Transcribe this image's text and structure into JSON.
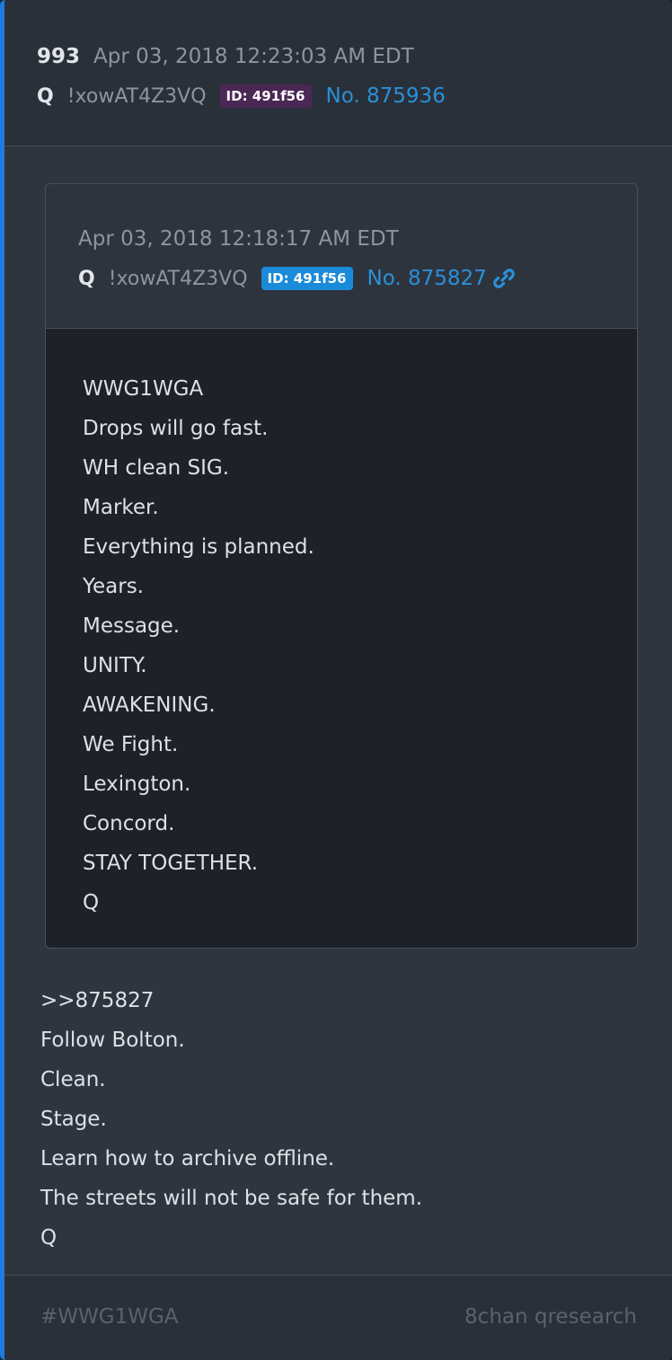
{
  "post": {
    "number": "993",
    "timestamp": "Apr 03, 2018 12:23:03 AM EDT",
    "author": "Q",
    "tripcode": "!xowAT4Z3VQ",
    "id_badge": "ID: 491f56",
    "post_link": "No. 875936",
    "accent_color": "#1e7be0"
  },
  "quoted": {
    "timestamp": "Apr 03, 2018 12:18:17 AM EDT",
    "author": "Q",
    "tripcode": "!xowAT4Z3VQ",
    "id_badge": "ID: 491f56",
    "post_link": "No. 875827",
    "link_icon": "link-icon",
    "lines": [
      "WWG1WGA",
      "Drops will go fast.",
      "WH clean SIG.",
      "Marker.",
      "Everything is planned.",
      "Years.",
      "Message.",
      "UNITY.",
      "AWAKENING.",
      "We Fight.",
      "Lexington.",
      "Concord.",
      "STAY TOGETHER.",
      "Q"
    ]
  },
  "body": {
    "lines": [
      ">>875827",
      "Follow Bolton.",
      "Clean.",
      "Stage.",
      "Learn how to archive offline.",
      "The streets will not be safe for them.",
      "Q"
    ]
  },
  "footer": {
    "hashtag": "#WWG1WGA",
    "source": "8chan qresearch"
  }
}
